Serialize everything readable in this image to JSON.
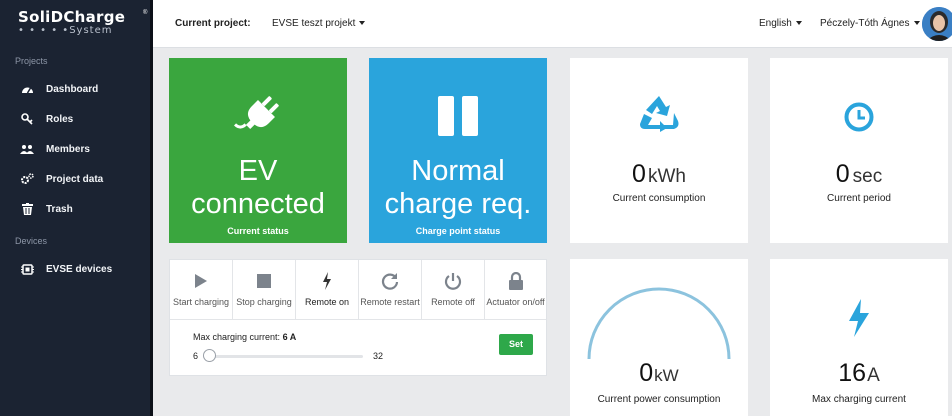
{
  "app": {
    "logo_main": "SoliDCharge",
    "logo_sub": "• • • • •System",
    "logo_reg": "®"
  },
  "sidebar": {
    "projects_label": "Projects",
    "devices_label": "Devices",
    "items": [
      {
        "label": "Dashboard",
        "icon": "dashboard-icon"
      },
      {
        "label": "Roles",
        "icon": "key-icon"
      },
      {
        "label": "Members",
        "icon": "users-icon"
      },
      {
        "label": "Project data",
        "icon": "cogs-icon"
      },
      {
        "label": "Trash",
        "icon": "trash-icon"
      }
    ],
    "device_items": [
      {
        "label": "EVSE devices",
        "icon": "device-icon"
      }
    ]
  },
  "topbar": {
    "project_label": "Current project:",
    "project_value": "EVSE teszt projekt",
    "language": "English",
    "user": "Péczely-Tóth Ágnes"
  },
  "status_cards": {
    "ev": {
      "line1": "EV",
      "line2": "connected",
      "caption": "Current status",
      "color": "#3aa63e",
      "icon": "plug-icon"
    },
    "charge": {
      "line1": "Normal",
      "line2": "charge req.",
      "caption": "Charge point status",
      "color": "#2aa4dc",
      "icon": "pause-icon"
    }
  },
  "metrics": {
    "consumption": {
      "value": "0",
      "unit": "kWh",
      "caption": "Current consumption",
      "icon": "recycle-icon"
    },
    "period": {
      "value": "0",
      "unit": "sec",
      "caption": "Current period",
      "icon": "clock-icon"
    },
    "power": {
      "value": "0",
      "unit": "kW",
      "caption": "Current power consumption",
      "icon": "gauge-icon"
    },
    "max_current": {
      "value": "16",
      "unit": "A",
      "caption": "Max charging current",
      "icon": "bolt-icon"
    }
  },
  "controls": {
    "buttons": [
      {
        "label": "Start charging",
        "icon": "play-icon"
      },
      {
        "label": "Stop charging",
        "icon": "stop-icon"
      },
      {
        "label": "Remote on",
        "icon": "bolt-icon"
      },
      {
        "label": "Remote restart",
        "icon": "refresh-icon"
      },
      {
        "label": "Remote off",
        "icon": "power-icon"
      },
      {
        "label": "Actuator on/off",
        "icon": "lock-icon"
      }
    ],
    "max_label": "Max charging current:",
    "max_value": "6 A",
    "slider_min": "6",
    "slider_max": "32",
    "slider_fraction": 0,
    "set_label": "Set"
  },
  "colors": {
    "accent_blue": "#2aa4dc",
    "green": "#3aa63e",
    "set_button": "#2ea84a",
    "sidebar_bg": "#1b2332"
  }
}
